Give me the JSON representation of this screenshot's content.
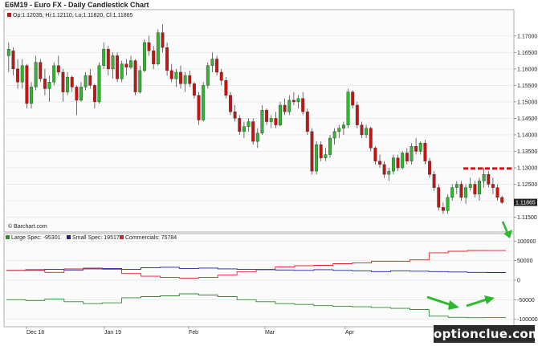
{
  "title": "E6M19 - Euro FX - Daily Candlestick Chart",
  "ohlc_label": "Op:1.12035, Hi:1.12110, Lo:1.11820, Cl:1.11865",
  "copyright": "© Barchart.com",
  "watermark": "optionclue.com",
  "colors": {
    "up": "#2db82d",
    "down": "#cc1111",
    "large": "#2e8b2e",
    "small": "#1f1f99",
    "commercials": "#e02020",
    "annotation": "#dd1111",
    "arrow": "#2db82d"
  },
  "chart_data": [
    {
      "type": "candlestick",
      "title": "E6M19 - Euro FX - Daily Candlestick Chart",
      "ylim": [
        1.111,
        1.1775
      ],
      "y_ticks": [
        1.115,
        1.12,
        1.125,
        1.13,
        1.135,
        1.14,
        1.145,
        1.15,
        1.155,
        1.16,
        1.165,
        1.17
      ],
      "y_tick_labels": [
        "1.11500",
        "1.12000",
        "1.12500",
        "1.13000",
        "1.13500",
        "1.14000",
        "1.14500",
        "1.15000",
        "1.15500",
        "1.16000",
        "1.16500",
        "1.17000"
      ],
      "last_value_label": "1.11865",
      "resistance_level": 1.1298,
      "ohlc": [
        [
          1.164,
          1.168,
          1.159,
          1.166
        ],
        [
          1.1655,
          1.1665,
          1.158,
          1.16
        ],
        [
          1.16,
          1.163,
          1.154,
          1.156
        ],
        [
          1.156,
          1.163,
          1.154,
          1.161
        ],
        [
          1.161,
          1.1615,
          1.148,
          1.1495
        ],
        [
          1.1495,
          1.156,
          1.148,
          1.1545
        ],
        [
          1.1545,
          1.164,
          1.1535,
          1.162
        ],
        [
          1.162,
          1.163,
          1.156,
          1.157
        ],
        [
          1.157,
          1.16,
          1.152,
          1.154
        ],
        [
          1.154,
          1.158,
          1.15,
          1.156
        ],
        [
          1.156,
          1.162,
          1.155,
          1.161
        ],
        [
          1.161,
          1.164,
          1.158,
          1.159
        ],
        [
          1.159,
          1.16,
          1.15,
          1.153
        ],
        [
          1.153,
          1.159,
          1.152,
          1.1575
        ],
        [
          1.1575,
          1.158,
          1.153,
          1.1545
        ],
        [
          1.1545,
          1.155,
          1.146,
          1.1505
        ],
        [
          1.1505,
          1.156,
          1.15,
          1.1545
        ],
        [
          1.1545,
          1.159,
          1.1535,
          1.158
        ],
        [
          1.158,
          1.16,
          1.154,
          1.155
        ],
        [
          1.155,
          1.1555,
          1.148,
          1.15
        ],
        [
          1.15,
          1.162,
          1.1495,
          1.161
        ],
        [
          1.161,
          1.168,
          1.16,
          1.166
        ],
        [
          1.166,
          1.167,
          1.158,
          1.16
        ],
        [
          1.16,
          1.165,
          1.157,
          1.164
        ],
        [
          1.164,
          1.165,
          1.156,
          1.157
        ],
        [
          1.157,
          1.1625,
          1.156,
          1.1615
        ],
        [
          1.1615,
          1.163,
          1.158,
          1.1605
        ],
        [
          1.1605,
          1.164,
          1.16,
          1.1625
        ],
        [
          1.1625,
          1.163,
          1.152,
          1.153
        ],
        [
          1.153,
          1.161,
          1.1525,
          1.1595
        ],
        [
          1.1595,
          1.169,
          1.159,
          1.168
        ],
        [
          1.168,
          1.17,
          1.164,
          1.1655
        ],
        [
          1.1655,
          1.167,
          1.16,
          1.1615
        ],
        [
          1.1615,
          1.172,
          1.161,
          1.171
        ],
        [
          1.171,
          1.1735,
          1.165,
          1.1665
        ],
        [
          1.1665,
          1.168,
          1.158,
          1.1595
        ],
        [
          1.1595,
          1.1615,
          1.156,
          1.157
        ],
        [
          1.157,
          1.16,
          1.1545,
          1.159
        ],
        [
          1.159,
          1.161,
          1.154,
          1.1555
        ],
        [
          1.1555,
          1.159,
          1.153,
          1.158
        ],
        [
          1.158,
          1.1595,
          1.1545,
          1.1555
        ],
        [
          1.1555,
          1.156,
          1.151,
          1.152
        ],
        [
          1.152,
          1.153,
          1.143,
          1.1445
        ],
        [
          1.1445,
          1.156,
          1.144,
          1.155
        ],
        [
          1.155,
          1.162,
          1.154,
          1.161
        ],
        [
          1.161,
          1.165,
          1.159,
          1.163
        ],
        [
          1.163,
          1.164,
          1.158,
          1.159
        ],
        [
          1.159,
          1.16,
          1.155,
          1.1565
        ],
        [
          1.1565,
          1.1575,
          1.151,
          1.152
        ],
        [
          1.152,
          1.153,
          1.146,
          1.147
        ],
        [
          1.147,
          1.149,
          1.144,
          1.145
        ],
        [
          1.145,
          1.146,
          1.14,
          1.141
        ],
        [
          1.141,
          1.144,
          1.139,
          1.1425
        ],
        [
          1.1425,
          1.145,
          1.141,
          1.144
        ],
        [
          1.144,
          1.145,
          1.137,
          1.138
        ],
        [
          1.138,
          1.142,
          1.136,
          1.1405
        ],
        [
          1.1405,
          1.149,
          1.14,
          1.1475
        ],
        [
          1.1475,
          1.148,
          1.143,
          1.144
        ],
        [
          1.144,
          1.146,
          1.142,
          1.145
        ],
        [
          1.145,
          1.147,
          1.142,
          1.143
        ],
        [
          1.143,
          1.15,
          1.1425,
          1.149
        ],
        [
          1.149,
          1.151,
          1.146,
          1.147
        ],
        [
          1.147,
          1.152,
          1.146,
          1.1505
        ],
        [
          1.1505,
          1.153,
          1.149,
          1.15
        ],
        [
          1.15,
          1.152,
          1.148,
          1.151
        ],
        [
          1.151,
          1.153,
          1.146,
          1.147
        ],
        [
          1.147,
          1.148,
          1.14,
          1.141
        ],
        [
          1.141,
          1.142,
          1.128,
          1.129
        ],
        [
          1.129,
          1.138,
          1.128,
          1.137
        ],
        [
          1.137,
          1.138,
          1.132,
          1.133
        ],
        [
          1.133,
          1.136,
          1.132,
          1.134
        ],
        [
          1.134,
          1.14,
          1.133,
          1.139
        ],
        [
          1.139,
          1.142,
          1.137,
          1.141
        ],
        [
          1.141,
          1.143,
          1.139,
          1.142
        ],
        [
          1.142,
          1.144,
          1.14,
          1.143
        ],
        [
          1.143,
          1.154,
          1.142,
          1.153
        ],
        [
          1.153,
          1.1535,
          1.148,
          1.149
        ],
        [
          1.149,
          1.15,
          1.142,
          1.143
        ],
        [
          1.143,
          1.144,
          1.139,
          1.14
        ],
        [
          1.14,
          1.143,
          1.139,
          1.142
        ],
        [
          1.142,
          1.1425,
          1.135,
          1.136
        ],
        [
          1.136,
          1.1365,
          1.131,
          1.132
        ],
        [
          1.132,
          1.134,
          1.13,
          1.131
        ],
        [
          1.131,
          1.132,
          1.127,
          1.128
        ],
        [
          1.128,
          1.13,
          1.126,
          1.129
        ],
        [
          1.129,
          1.134,
          1.128,
          1.133
        ],
        [
          1.133,
          1.134,
          1.129,
          1.13
        ],
        [
          1.13,
          1.135,
          1.1295,
          1.1345
        ],
        [
          1.1345,
          1.136,
          1.131,
          1.132
        ],
        [
          1.132,
          1.1375,
          1.131,
          1.1365
        ],
        [
          1.1365,
          1.139,
          1.134,
          1.135
        ],
        [
          1.135,
          1.138,
          1.134,
          1.1375
        ],
        [
          1.1375,
          1.1385,
          1.131,
          1.132
        ],
        [
          1.132,
          1.133,
          1.127,
          1.128
        ],
        [
          1.128,
          1.129,
          1.123,
          1.124
        ],
        [
          1.124,
          1.125,
          1.117,
          1.118
        ],
        [
          1.118,
          1.1195,
          1.116,
          1.117
        ],
        [
          1.117,
          1.122,
          1.116,
          1.121
        ],
        [
          1.121,
          1.125,
          1.12,
          1.124
        ],
        [
          1.124,
          1.126,
          1.122,
          1.125
        ],
        [
          1.125,
          1.126,
          1.12,
          1.121
        ],
        [
          1.121,
          1.125,
          1.119,
          1.124
        ],
        [
          1.124,
          1.127,
          1.123,
          1.125
        ],
        [
          1.125,
          1.126,
          1.121,
          1.122
        ],
        [
          1.122,
          1.127,
          1.12,
          1.126
        ],
        [
          1.126,
          1.13,
          1.124,
          1.128
        ],
        [
          1.128,
          1.129,
          1.124,
          1.125
        ],
        [
          1.125,
          1.127,
          1.122,
          1.124
        ],
        [
          1.124,
          1.125,
          1.12,
          1.121
        ],
        [
          1.121,
          1.1215,
          1.119,
          1.1195
        ]
      ]
    },
    {
      "type": "line",
      "title": "",
      "ylim": [
        -115000,
        115000
      ],
      "y_ticks": [
        100000,
        50000,
        0,
        -50000,
        -100000
      ],
      "y_tick_labels": [
        "100000",
        "50000",
        "0",
        "-50000",
        "-100000"
      ],
      "x_tick_labels": [
        "Dec 18",
        "Jan 19",
        "Feb",
        "Mar",
        "Apr"
      ],
      "series": [
        {
          "name": "Large Spec: -95301",
          "values": [
            -50000,
            -52000,
            -48000,
            -55000,
            -60000,
            -58000,
            -45000,
            -42000,
            -40000,
            -35000,
            -38000,
            -42000,
            -50000,
            -55000,
            -60000,
            -62000,
            -65000,
            -67000,
            -68000,
            -70000,
            -72000,
            -75000,
            -92000,
            -95000,
            -96000,
            -95301
          ]
        },
        {
          "name": "Small Spec: 19517",
          "values": [
            25000,
            27000,
            28000,
            26000,
            29000,
            30000,
            28000,
            32000,
            33000,
            30000,
            31000,
            29000,
            28000,
            27000,
            26000,
            25000,
            27000,
            25000,
            24000,
            22000,
            24000,
            23000,
            22000,
            21000,
            20000,
            19517
          ]
        },
        {
          "name": "Commercials: 75784",
          "values": [
            25000,
            25000,
            20000,
            29000,
            31000,
            28000,
            17000,
            10000,
            7000,
            5000,
            7000,
            13000,
            22000,
            28000,
            34000,
            37000,
            38000,
            42000,
            44000,
            48000,
            48000,
            52000,
            70000,
            74000,
            76000,
            75784
          ]
        }
      ]
    }
  ]
}
